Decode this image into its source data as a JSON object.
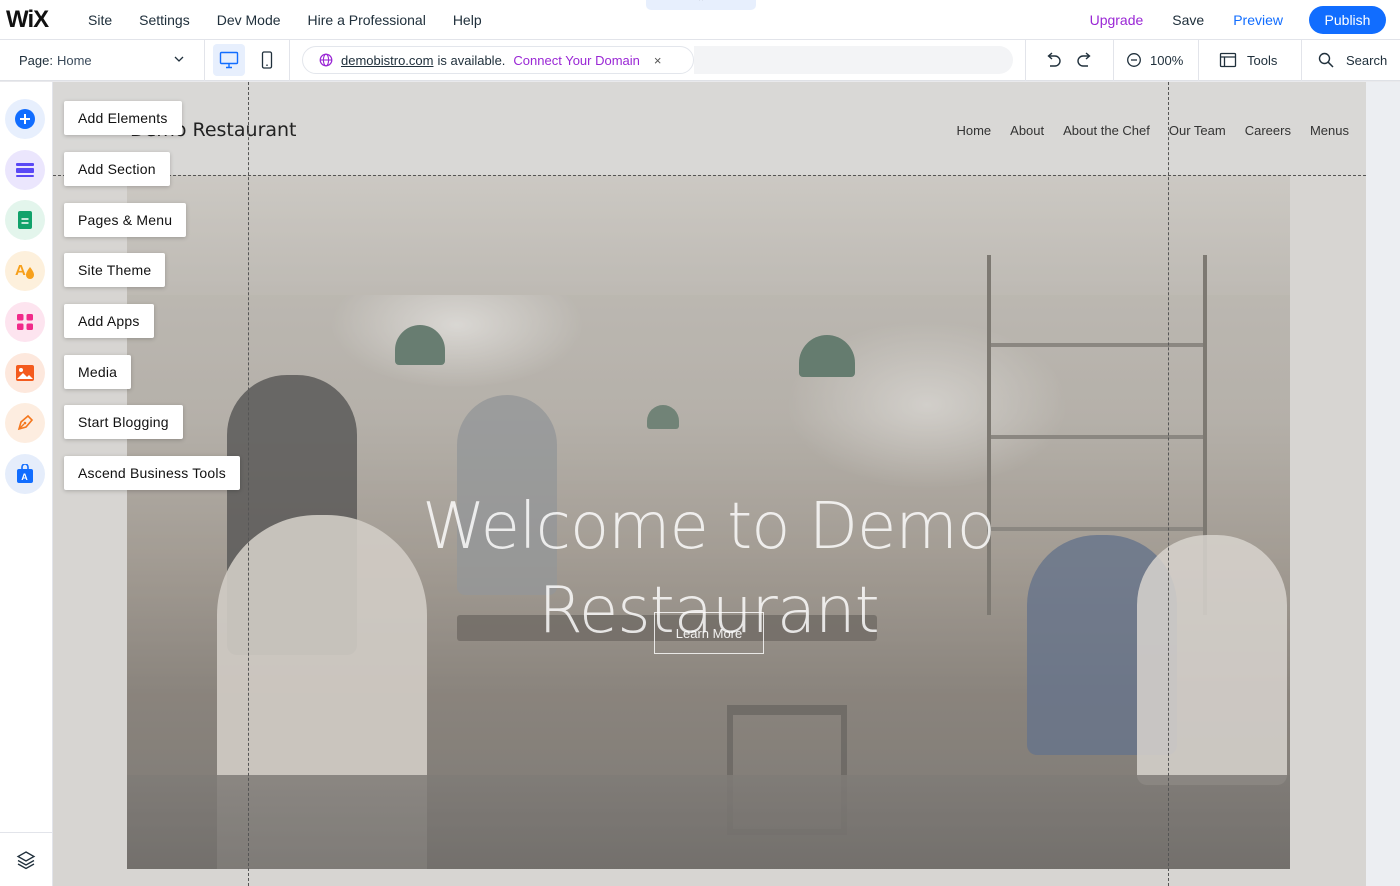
{
  "topbar": {
    "logo": "WiX",
    "menu": [
      "Site",
      "Settings",
      "Dev Mode",
      "Hire a Professional",
      "Help"
    ],
    "collapse_glyph": "⌃",
    "upgrade": "Upgrade",
    "save": "Save",
    "preview": "Preview",
    "publish": "Publish"
  },
  "subbar": {
    "page_label": "Page:",
    "page_value": "Home",
    "devices": [
      "desktop-icon",
      "mobile-icon"
    ],
    "domain": {
      "name": "demobistro.com",
      "available_text": "is available.",
      "connect": "Connect Your Domain",
      "close": "×"
    },
    "zoom": "100%",
    "tools": "Tools",
    "search": "Search"
  },
  "rail": {
    "buttons": [
      {
        "icon": "plus-icon",
        "color": "#116dff",
        "bg": "#e7effd"
      },
      {
        "icon": "section-icon",
        "color": "#5a48f5",
        "bg": "#ebe6fd"
      },
      {
        "icon": "pages-icon",
        "color": "#11a26b",
        "bg": "#e3f5ec"
      },
      {
        "icon": "theme-icon",
        "color": "#f7a01b",
        "bg": "#fdf0dc"
      },
      {
        "icon": "apps-icon",
        "color": "#f12a8a",
        "bg": "#fde4ef"
      },
      {
        "icon": "media-icon",
        "color": "#f45b1e",
        "bg": "#fde8dd"
      },
      {
        "icon": "blog-icon",
        "color": "#f4771e",
        "bg": "#fdede0"
      },
      {
        "icon": "business-icon",
        "color": "#116dff",
        "bg": "#e5edfb"
      }
    ],
    "bottom_icon": "layers-icon"
  },
  "panel_labels": [
    "Add Elements",
    "Add Section",
    "Pages & Menu",
    "Site Theme",
    "Add Apps",
    "Media",
    "Start Blogging",
    "Ascend Business Tools"
  ],
  "site": {
    "title": "Demo Restaurant",
    "nav": [
      "Home",
      "About",
      "About the Chef",
      "Our Team",
      "Careers",
      "Menus"
    ],
    "hero_line1": "Welcome to Demo",
    "hero_line2": "Restaurant",
    "cta": "Learn More"
  }
}
